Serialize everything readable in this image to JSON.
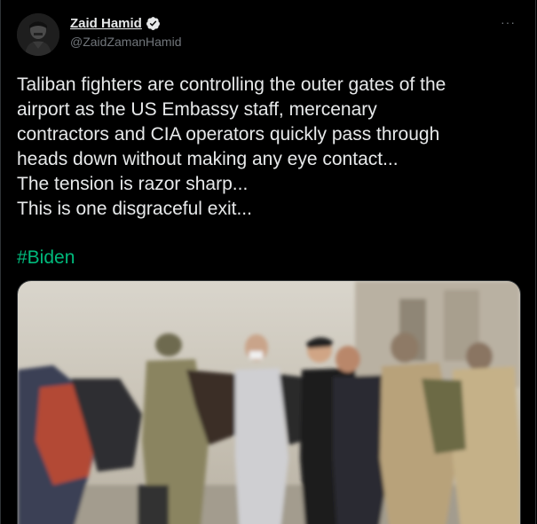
{
  "author": {
    "display_name": "Zaid Hamid",
    "handle": "@ZaidZamanHamid",
    "verified": true,
    "avatar_icon": "profile-photo"
  },
  "more_options_label": "···",
  "tweet": {
    "lines": [
      "Taliban fighters are controlling the outer gates of the",
      "airport as the US Embassy staff, mercenary",
      "contractors and CIA operators quickly pass through",
      "heads down without making any eye contact...",
      "The tension is razor sharp...",
      "This is one disgraceful exit..."
    ],
    "hashtag": "#Biden"
  },
  "colors": {
    "background": "#000000",
    "text": "#e7e9ea",
    "muted": "#71767b",
    "hashtag": "#00ba7c",
    "verified_badge": "#e7e9ea"
  }
}
